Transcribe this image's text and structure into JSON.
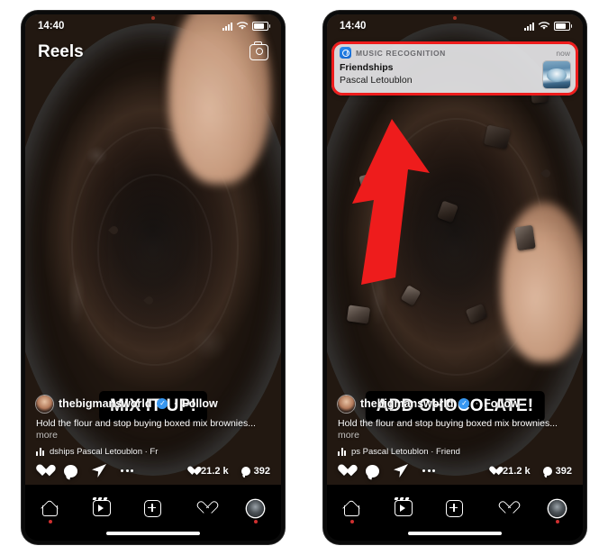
{
  "screenshot": {
    "title": "Instagram Reels with iOS Music Recognition notification",
    "background": "#ffffff",
    "accent_red": "#ee1c1c"
  },
  "phones": [
    {
      "id": "left",
      "status_bar": {
        "time": "14:40",
        "signal_icon": "cellular-signal-icon",
        "wifi_icon": "wifi-icon",
        "battery_icon": "battery-icon"
      },
      "header": {
        "title": "Reels",
        "camera_icon": "camera-icon"
      },
      "video_caption_sticker": "MIX IT UP!",
      "post": {
        "avatar": "avatar",
        "username": "thebigmansworld",
        "verified_icon": "verified-badge-icon",
        "separator": "·",
        "follow_label": "Follow",
        "caption": "Hold the flour and stop buying boxed mix brownies...",
        "caption_more": "more",
        "audio_icon": "music-note-icon",
        "audio_text": "dships   Pascal Letoublon · Fr",
        "like_count": "21.2 k",
        "comment_count": "392",
        "like_icon": "heart-icon",
        "comment_icon": "comment-bubble-icon",
        "share_icon": "share-paper-plane-icon",
        "more_icon": "more-options-icon"
      },
      "tab_bar": {
        "items": [
          {
            "name": "home",
            "icon": "home-icon",
            "badge": true
          },
          {
            "name": "reels",
            "icon": "reels-icon",
            "badge": false
          },
          {
            "name": "create",
            "icon": "plus-square-icon",
            "badge": false
          },
          {
            "name": "activity",
            "icon": "heart-outline-icon",
            "badge": false
          },
          {
            "name": "profile",
            "icon": "profile-avatar-icon",
            "badge": true
          }
        ],
        "home_indicator": "home-indicator"
      },
      "notification": null
    },
    {
      "id": "right",
      "status_bar": {
        "time": "14:40",
        "signal_icon": "cellular-signal-icon",
        "wifi_icon": "wifi-icon",
        "battery_icon": "battery-icon"
      },
      "header": {
        "title": "Reels",
        "camera_icon": "camera-icon"
      },
      "video_caption_sticker": "ADD CHOCOLATE!",
      "post": {
        "avatar": "avatar",
        "username": "thebigmansworld",
        "verified_icon": "verified-badge-icon",
        "separator": "·",
        "follow_label": "Follow",
        "caption": "Hold the flour and stop buying boxed mix brownies...",
        "caption_more": "more",
        "audio_icon": "music-note-icon",
        "audio_text": "ps   Pascal Letoublon · Friend",
        "like_count": "21.2 k",
        "comment_count": "392",
        "like_icon": "heart-icon",
        "comment_icon": "comment-bubble-icon",
        "share_icon": "share-paper-plane-icon",
        "more_icon": "more-options-icon"
      },
      "tab_bar": {
        "items": [
          {
            "name": "home",
            "icon": "home-icon",
            "badge": true
          },
          {
            "name": "reels",
            "icon": "reels-icon",
            "badge": false
          },
          {
            "name": "create",
            "icon": "plus-square-icon",
            "badge": false
          },
          {
            "name": "activity",
            "icon": "heart-outline-icon",
            "badge": false
          },
          {
            "name": "profile",
            "icon": "profile-avatar-icon",
            "badge": true
          }
        ],
        "home_indicator": "home-indicator"
      },
      "notification": {
        "app_icon": "shazam-icon",
        "app_name": "MUSIC RECOGNITION",
        "time": "now",
        "title": "Friendships",
        "subtitle": "Pascal Letoublon",
        "artwork": "album-artwork",
        "highlight_color": "#ee1c1c"
      }
    }
  ],
  "annotations": {
    "arrow": {
      "name": "red-arrow-annotation",
      "color": "#ee1c1c",
      "points_to": "notification-banner"
    },
    "highlight_box": {
      "name": "red-highlight-box",
      "color": "#ee1c1c",
      "surrounds": "notification-banner"
    }
  }
}
